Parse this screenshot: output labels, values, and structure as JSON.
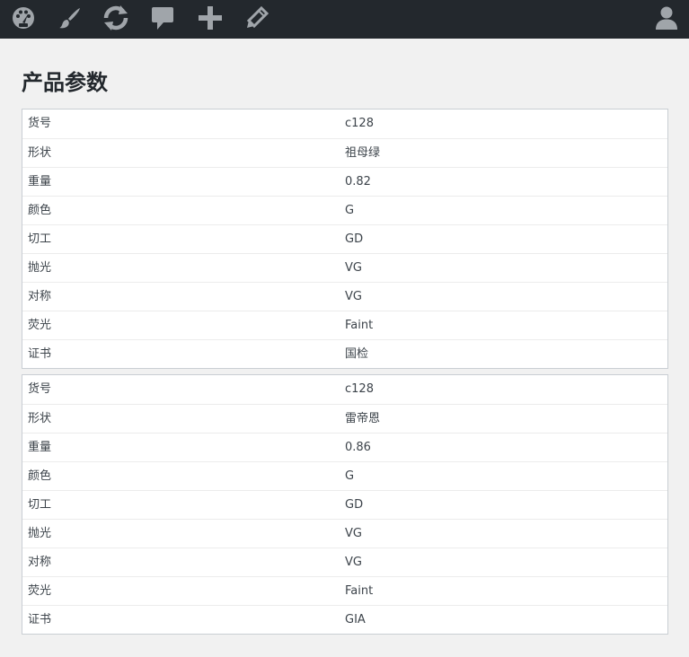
{
  "toolbar": {
    "icons": [
      "dashboard-icon",
      "customize-brush-icon",
      "updates-refresh-icon",
      "comments-icon",
      "new-content-plus-icon",
      "edit-pencil-icon",
      "user-account-icon"
    ]
  },
  "page": {
    "title": "产品参数"
  },
  "tables": [
    {
      "rows": [
        {
          "key": "货号",
          "value": "c128"
        },
        {
          "key": "形状",
          "value": "祖母绿"
        },
        {
          "key": "重量",
          "value": "0.82"
        },
        {
          "key": "颜色",
          "value": "G"
        },
        {
          "key": "切工",
          "value": "GD"
        },
        {
          "key": "抛光",
          "value": "VG"
        },
        {
          "key": "对称",
          "value": "VG"
        },
        {
          "key": "荧光",
          "value": "Faint"
        },
        {
          "key": "证书",
          "value": "国检"
        }
      ]
    },
    {
      "rows": [
        {
          "key": "货号",
          "value": "c128"
        },
        {
          "key": "形状",
          "value": "雷帝恩"
        },
        {
          "key": "重量",
          "value": "0.86"
        },
        {
          "key": "颜色",
          "value": "G"
        },
        {
          "key": "切工",
          "value": "GD"
        },
        {
          "key": "抛光",
          "value": "VG"
        },
        {
          "key": "对称",
          "value": "VG"
        },
        {
          "key": "荧光",
          "value": "Faint"
        },
        {
          "key": "证书",
          "value": "GIA"
        }
      ]
    }
  ],
  "colors": {
    "toolbar_bg": "#23282d",
    "toolbar_icon": "#a0a5aa",
    "page_bg": "#f1f1f1"
  }
}
